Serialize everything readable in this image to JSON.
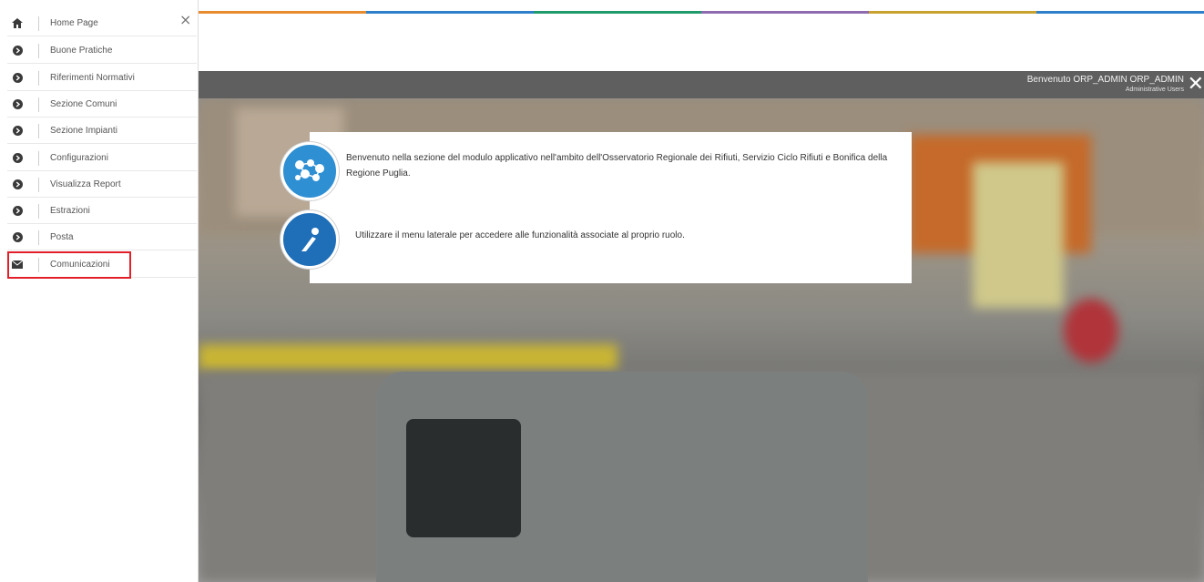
{
  "colors": {
    "strip": [
      "#e88a2e",
      "#2e7fc9",
      "#1f9a6a",
      "#8e6bb0",
      "#c9a12e",
      "#2e7fc9"
    ],
    "highlight": "#e2202a",
    "header": "#5f5f5f",
    "info_icon": "#2f8fd3"
  },
  "sidebar": {
    "close_icon": "×",
    "items": [
      {
        "label": "Home Page",
        "icon": "home-icon"
      },
      {
        "label": "Buone Pratiche",
        "icon": "circle-arrow-icon"
      },
      {
        "label": "Riferimenti Normativi",
        "icon": "circle-arrow-icon"
      },
      {
        "label": "Sezione Comuni",
        "icon": "circle-arrow-icon"
      },
      {
        "label": "Sezione Impianti",
        "icon": "circle-arrow-icon"
      },
      {
        "label": "Configurazioni",
        "icon": "circle-arrow-icon"
      },
      {
        "label": "Visualizza Report",
        "icon": "circle-arrow-icon"
      },
      {
        "label": "Estrazioni",
        "icon": "circle-arrow-icon"
      },
      {
        "label": "Posta",
        "icon": "circle-arrow-icon"
      },
      {
        "label": "Comunicazioni",
        "icon": "envelope-icon"
      }
    ]
  },
  "header": {
    "welcome": "Benvenuto ORP_ADMIN ORP_ADMIN",
    "role": "Administrative Users",
    "close_icon": "✕"
  },
  "card": {
    "welcome_text": "Benvenuto nella sezione del modulo applicativo nell'ambito dell'Osservatorio Regionale dei Rifiuti, Servizio Ciclo Rifiuti e Bonifica della Regione Puglia.",
    "info_text": "Utilizzare il menu laterale per accedere alle funzionalità associate al proprio ruolo."
  }
}
